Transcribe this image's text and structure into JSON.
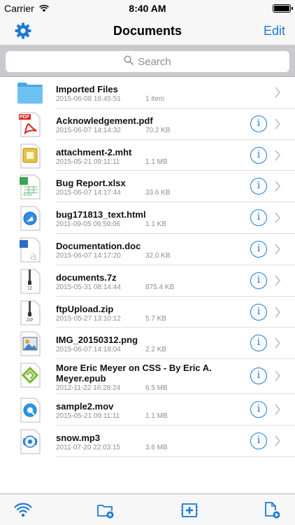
{
  "status_bar": {
    "carrier": "Carrier",
    "time": "8:40 AM"
  },
  "nav": {
    "title": "Documents",
    "edit_label": "Edit"
  },
  "search": {
    "placeholder": "Search"
  },
  "files": [
    {
      "name": "Imported Files",
      "date": "2015-06-08 16:45:51",
      "size": "1 item",
      "type": "folder",
      "info": false
    },
    {
      "name": "Acknowledgement.pdf",
      "date": "2015-06-07 14:14:32",
      "size": "70.2 KB",
      "type": "pdf",
      "info": true
    },
    {
      "name": "attachment-2.mht",
      "date": "2015-05-21 09:11:11",
      "size": "1.1 MB",
      "type": "mht",
      "info": true
    },
    {
      "name": "Bug Report.xlsx",
      "date": "2015-06-07 14:17:44",
      "size": "33.6 KB",
      "type": "xlsx",
      "info": true
    },
    {
      "name": "bug171813_text.html",
      "date": "2011-09-05 09:59:06",
      "size": "1.1 KB",
      "type": "html",
      "info": true
    },
    {
      "name": "Documentation.doc",
      "date": "2015-06-07 14:17:20",
      "size": "32.0 KB",
      "type": "doc",
      "info": true
    },
    {
      "name": "documents.7z",
      "date": "2015-05-31 08:14:44",
      "size": "875.4 KB",
      "type": "7z",
      "info": true
    },
    {
      "name": "ftpUpload.zip",
      "date": "2015-05-27 13:10:12",
      "size": "5.7 KB",
      "type": "zip",
      "info": true
    },
    {
      "name": "IMG_20150312.png",
      "date": "2015-06-07 14:18:04",
      "size": "2.2 KB",
      "type": "png",
      "info": true
    },
    {
      "name": "More Eric Meyer on CSS - By Eric A. Meyer.epub",
      "name_line1": "More Eric Meyer on CSS - By Eric A.",
      "name_line2": "Meyer.epub",
      "date": "2012-11-22 16:28:24",
      "size": "6.5 MB",
      "type": "epub",
      "info": true
    },
    {
      "name": "sample2.mov",
      "date": "2015-05-21 09:11:11",
      "size": "1.1 MB",
      "type": "mov",
      "info": true
    },
    {
      "name": "snow.mp3",
      "date": "2011-07-20 22:03:15",
      "size": "3.6 MB",
      "type": "mp3",
      "info": true
    }
  ],
  "file_type_labels": {
    "pdf": "PDF",
    "xlsx": "XLSX",
    "7z": "7Z",
    "zip": "ZIP"
  },
  "info_glyph": "i",
  "tab_bar": {
    "icons": [
      "wifi-icon",
      "new-folder-icon",
      "add-image-icon",
      "new-file-icon"
    ]
  },
  "colors": {
    "accent": "#1a7ad8",
    "secondary_text": "#8e8e93",
    "bar_bg": "#f7f7f8",
    "search_bg": "#c9c9ce"
  }
}
